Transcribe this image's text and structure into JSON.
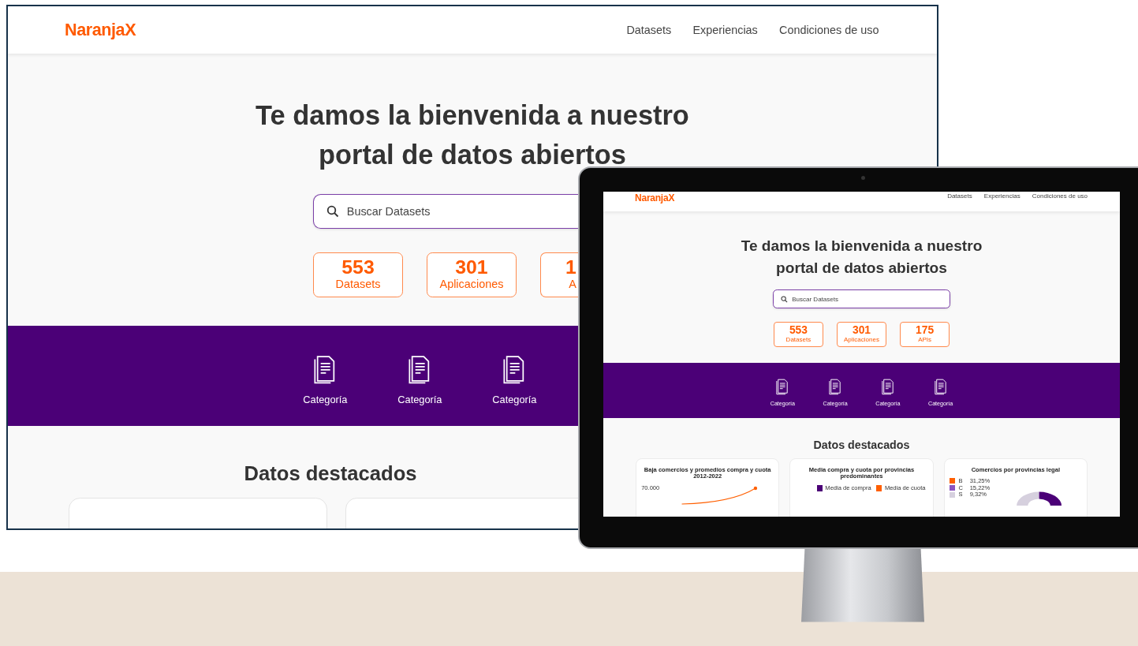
{
  "desktop_view": {
    "logo": "NaranjaX",
    "nav": [
      "Datasets",
      "Experiencias",
      "Condiciones de uso"
    ],
    "title_lines": [
      "Te damos la bienvenida a nuestro",
      "portal de datos abiertos"
    ],
    "search": {
      "placeholder": "Buscar Datasets"
    },
    "stats": [
      {
        "value": "553",
        "label": "Datasets"
      },
      {
        "value": "301",
        "label": "Aplicaciones"
      },
      {
        "value": "1",
        "label": "A"
      }
    ],
    "categories": [
      "Categoría",
      "Categoría",
      "Categoría"
    ],
    "section_title": "Datos destacados",
    "cards": [
      {
        "kind": "empty"
      },
      {
        "kind": "empty"
      }
    ]
  },
  "monitor_view": {
    "logo": "NaranjaX",
    "nav": [
      "Datasets",
      "Experiencias",
      "Condiciones de uso"
    ],
    "title_lines": [
      "Te damos la bienvenida a nuestro",
      "portal de datos abiertos"
    ],
    "search": {
      "placeholder": "Buscar Datasets"
    },
    "stats": [
      {
        "value": "553",
        "label": "Datasets"
      },
      {
        "value": "301",
        "label": "Aplicaciones"
      },
      {
        "value": "175",
        "label": "APIs"
      }
    ],
    "categories": [
      "Categoría",
      "Categoría",
      "Categoría",
      "Categoría"
    ],
    "section_title": "Datos destacados",
    "cards": [
      {
        "kind": "line",
        "title": "Baja comercios y promedios compra y cuota 2012-2022",
        "ticks": [
          "70.000"
        ]
      },
      {
        "kind": "bar",
        "title": "Media compra y cuota por provincias predominantes",
        "legend": [
          {
            "label": "Media de compra",
            "color": "#4b0077"
          },
          {
            "label": "Media de cuota",
            "color": "#ff5f00"
          }
        ]
      },
      {
        "kind": "donut",
        "title": "Comercios por provincias legal",
        "legend": [
          {
            "label": "B",
            "value": "31,25%",
            "color": "#ff5f00"
          },
          {
            "label": "C",
            "value": "15,22%",
            "color": "#8b54c1"
          },
          {
            "label": "S",
            "value": "9,32%",
            "color": "#d6d0de"
          }
        ]
      }
    ]
  }
}
